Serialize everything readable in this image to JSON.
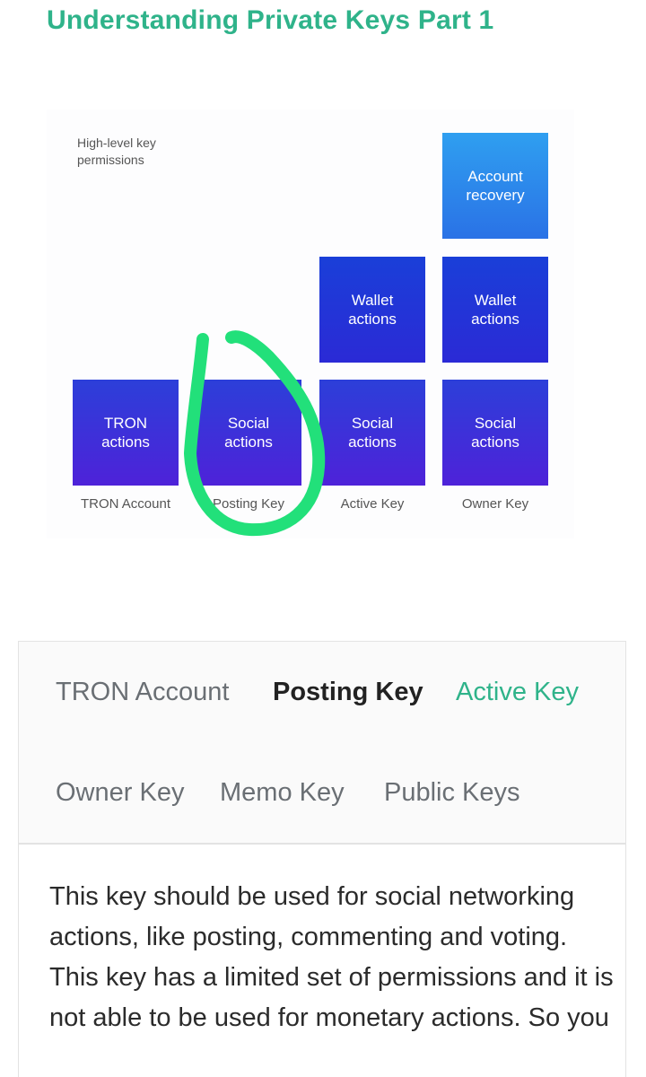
{
  "title": "Understanding Private Keys Part 1",
  "diagram": {
    "caption": "High-level key permissions",
    "blocks": {
      "tron_actions": "TRON actions",
      "posting_social": "Social actions",
      "active_wallet": "Wallet actions",
      "active_social": "Social actions",
      "owner_recovery": "Account recovery",
      "owner_wallet": "Wallet actions",
      "owner_social": "Social actions"
    },
    "labels": {
      "tron": "TRON Account",
      "posting": "Posting Key",
      "active": "Active Key",
      "owner": "Owner Key"
    },
    "highlight_color": "#22e07a"
  },
  "tabs": [
    {
      "label": "TRON Account"
    },
    {
      "label": "Posting Key"
    },
    {
      "label": "Active Key"
    },
    {
      "label": "Owner Key"
    },
    {
      "label": "Memo Key"
    },
    {
      "label": "Public Keys"
    }
  ],
  "content": {
    "text": "This key should be used for social networking actions, like posting, commenting and voting. This key has a limited set of permissions and it is not able to be used for monetary actions. So you"
  },
  "colors": {
    "accent": "#2fb38a",
    "block_blue": "#1a3fd8",
    "block_purple": "#4e22d9",
    "block_light": "#2f9ff0"
  }
}
